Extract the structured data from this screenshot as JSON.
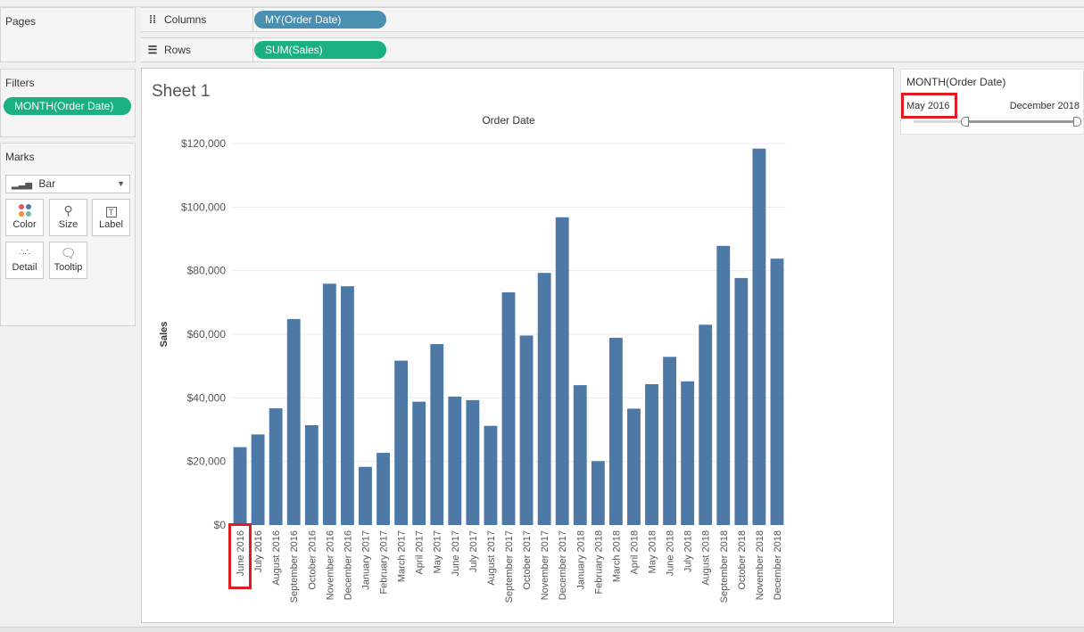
{
  "pages": {
    "title": "Pages"
  },
  "shelves": {
    "columns": {
      "label": "Columns",
      "icon": "columns-icon",
      "pill": "MY(Order Date)",
      "pill_color": "#4a8fb0"
    },
    "rows": {
      "label": "Rows",
      "icon": "rows-icon",
      "pill": "SUM(Sales)",
      "pill_color": "#1ab081"
    }
  },
  "filters": {
    "title": "Filters",
    "pill": "MONTH(Order Date)"
  },
  "marks": {
    "title": "Marks",
    "type": "Bar",
    "cards": [
      {
        "label": "Color",
        "icon": "color-icon"
      },
      {
        "label": "Size",
        "icon": "size-icon"
      },
      {
        "label": "Label",
        "icon": "label-icon"
      },
      {
        "label": "Detail",
        "icon": "detail-icon"
      },
      {
        "label": "Tooltip",
        "icon": "tooltip-icon"
      }
    ]
  },
  "sheet": {
    "title": "Sheet 1"
  },
  "slider": {
    "title": "MONTH(Order Date)",
    "start": "May 2016",
    "end": "December 2018"
  },
  "colors": {
    "bar": "#4e79a7",
    "highlight": "#e01b22"
  },
  "chart_data": {
    "type": "bar",
    "title": "Order Date",
    "xlabel": "",
    "ylabel": "Sales",
    "ylim": [
      0,
      120000
    ],
    "yticks": [
      "$0",
      "$20,000",
      "$40,000",
      "$60,000",
      "$80,000",
      "$100,000",
      "$120,000"
    ],
    "grid": true,
    "categories": [
      "June 2016",
      "July 2016",
      "August 2016",
      "September 2016",
      "October 2016",
      "November 2016",
      "December 2016",
      "January 2017",
      "February 2017",
      "March 2017",
      "April 2017",
      "May 2017",
      "June 2017",
      "July 2017",
      "August 2017",
      "September 2017",
      "October 2017",
      "November 2017",
      "December 2017",
      "January 2018",
      "February 2018",
      "March 2018",
      "April 2018",
      "May 2018",
      "June 2018",
      "July 2018",
      "August 2018",
      "September 2018",
      "October 2018",
      "November 2018",
      "December 2018"
    ],
    "values": [
      24500,
      28500,
      36700,
      64800,
      31400,
      75900,
      75100,
      18300,
      22700,
      51700,
      38800,
      56900,
      40400,
      39300,
      31200,
      73200,
      59600,
      79300,
      96800,
      44000,
      20100,
      58900,
      36600,
      44300,
      52900,
      45200,
      63000,
      87800,
      77700,
      118400,
      83800
    ]
  }
}
